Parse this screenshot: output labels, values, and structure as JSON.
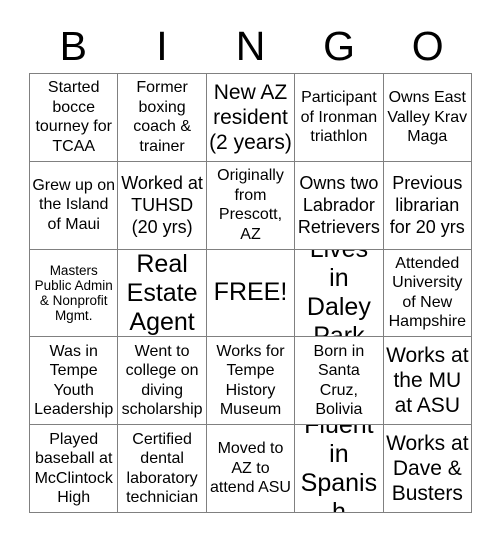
{
  "header": {
    "letters": [
      "B",
      "I",
      "N",
      "G",
      "O"
    ]
  },
  "grid": {
    "columns": 5,
    "rows": 5,
    "border_color": "#808080",
    "background_color": "#ffffff",
    "text_color": "#000000",
    "cells": [
      {
        "text": "Started bocce tourney for TCAA",
        "size": "s",
        "free": false
      },
      {
        "text": "Former boxing coach & trainer",
        "size": "s",
        "free": false
      },
      {
        "text": "New AZ resident (2 years)",
        "size": "l",
        "free": false
      },
      {
        "text": "Participant of Ironman triathlon",
        "size": "s",
        "free": false
      },
      {
        "text": "Owns East Valley Krav Maga",
        "size": "s",
        "free": false
      },
      {
        "text": "Grew up on the Island of Maui",
        "size": "s",
        "free": false
      },
      {
        "text": "Worked at TUHSD (20 yrs)",
        "size": "m",
        "free": false
      },
      {
        "text": "Originally from Prescott, AZ",
        "size": "s",
        "free": false
      },
      {
        "text": "Owns two Labrador Retrievers",
        "size": "m",
        "free": false
      },
      {
        "text": "Previous librarian for 20 yrs",
        "size": "m",
        "free": false
      },
      {
        "text": "Masters Public Admin & Nonprofit Mgmt.",
        "size": "xs",
        "free": false
      },
      {
        "text": "Real Estate Agent",
        "size": "xl",
        "free": false
      },
      {
        "text": "FREE!",
        "size": "xl",
        "free": true
      },
      {
        "text": "Lives in Daley Park",
        "size": "xl",
        "free": false
      },
      {
        "text": "Attended University of New Hampshire",
        "size": "s",
        "free": false
      },
      {
        "text": "Was in Tempe Youth Leadership",
        "size": "s",
        "free": false
      },
      {
        "text": "Went to college on diving scholarship",
        "size": "s",
        "free": false
      },
      {
        "text": "Works for Tempe History Museum",
        "size": "s",
        "free": false
      },
      {
        "text": "Born in Santa Cruz, Bolivia",
        "size": "s",
        "free": false
      },
      {
        "text": "Works at the MU at ASU",
        "size": "l",
        "free": false
      },
      {
        "text": "Played baseball at McClintock High",
        "size": "s",
        "free": false
      },
      {
        "text": "Certified dental laboratory technician",
        "size": "s",
        "free": false
      },
      {
        "text": "Moved to AZ to attend ASU",
        "size": "s",
        "free": false
      },
      {
        "text": "Fluent in Spanish",
        "size": "xl",
        "free": false
      },
      {
        "text": "Works at Dave & Busters",
        "size": "l",
        "free": false
      }
    ]
  }
}
